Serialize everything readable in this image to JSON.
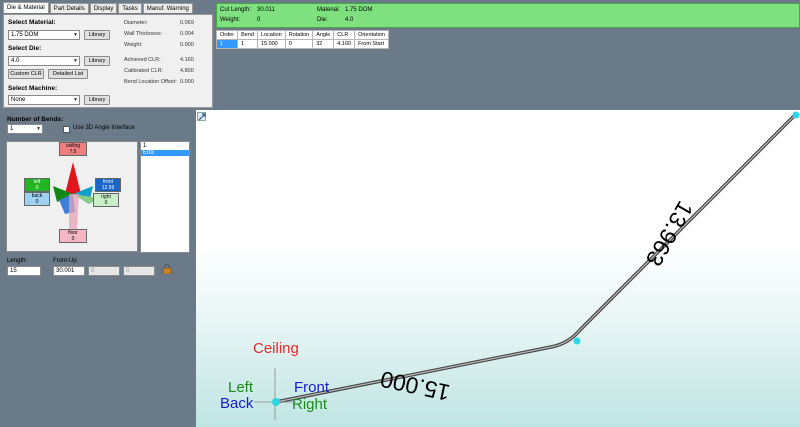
{
  "tabs": [
    "Die & Material",
    "Part Details",
    "Display",
    "Tasks",
    "Manuf. Warning"
  ],
  "die_material": {
    "select_material_label": "Select Material:",
    "material_value": "1.75 DOM",
    "select_die_label": "Select Die:",
    "die_value": "4.0",
    "library_label": "Library",
    "custom_clr_label": "Custom CLR",
    "detailed_list_label": "Detailed List",
    "select_machine_label": "Select Machine:",
    "machine_value": "None",
    "stats": [
      {
        "label": "Diameter:",
        "value": "0.069"
      },
      {
        "label": "Wall Thickness:",
        "value": "0.004"
      },
      {
        "label": "Weight:",
        "value": "0.000"
      },
      {
        "label": "Achieved CLR:",
        "value": "4.160"
      },
      {
        "label": "Calibrated CLR:",
        "value": "4.800"
      },
      {
        "label": "Bend Location Offset:",
        "value": "0.000"
      }
    ]
  },
  "info_bar": {
    "cut_length_label": "Cut Length:",
    "cut_length_value": "30.011",
    "weight_label": "Weight:",
    "weight_value": "0",
    "material_label": "Material:",
    "material_value": "1.75 DOM",
    "die_label": "Die:",
    "die_value": "4.0"
  },
  "bend_table": {
    "headers": [
      "Order",
      "Bend",
      "Location",
      "Rotation",
      "Angle",
      "CLR",
      "Orientation"
    ],
    "rows": [
      [
        "1",
        "1",
        "15.000",
        "0",
        "32",
        "4.160",
        "From Start"
      ]
    ]
  },
  "bends_panel": {
    "number_label": "Number of Bends:",
    "number_value": "1",
    "use_3d_label": "Use 3D Angle Interface",
    "orient": {
      "ceiling_label": "ceiling",
      "ceiling_value": "7.5",
      "left_label": "left",
      "left_value": "0",
      "back_label": "back",
      "back_value": "0",
      "front_label": "front",
      "front_value": "12.99",
      "right_label": "right",
      "right_value": "0",
      "floor_label": "floor",
      "floor_value": "0"
    },
    "list_items": [
      "1",
      "End"
    ],
    "length_label": "Length:",
    "length_value": "15",
    "frontup_label": "Front-Up",
    "frontup_value": "30.001",
    "field3_value": "0",
    "field4_value": "0"
  },
  "viewport": {
    "seg1_label": "15.000",
    "seg2_label": "13.963",
    "axis_ceiling": "Ceiling",
    "axis_left": "Left",
    "axis_back": "Back",
    "axis_front": "Front",
    "axis_right": "Right"
  },
  "colors": {
    "info_bar": "#7fe07f",
    "ceiling": "#e8585a",
    "left_axis": "#1a8c1a",
    "back_axis": "#1a1acc",
    "node": "#2fd6e6"
  }
}
